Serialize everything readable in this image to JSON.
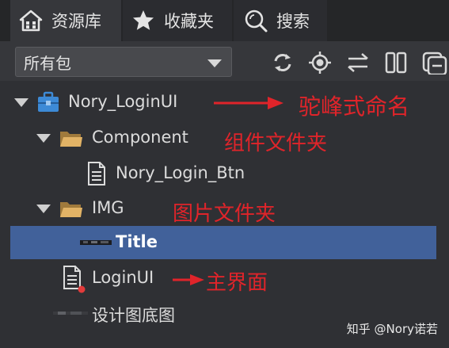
{
  "tabs": [
    {
      "label": "资源库",
      "icon": "home-icon"
    },
    {
      "label": "收藏夹",
      "icon": "star-icon"
    },
    {
      "label": "搜索",
      "icon": "search-icon"
    }
  ],
  "toolbar": {
    "package_filter": "所有包",
    "tools": [
      "refresh-icon",
      "locate-icon",
      "swap-icon",
      "columns-icon",
      "collapse-icon"
    ]
  },
  "tree": [
    {
      "label": "Nory_LoginUI",
      "icon": "package-icon"
    },
    {
      "label": "Component",
      "icon": "folder-icon"
    },
    {
      "label": "Nory_Login_Btn",
      "icon": "component-file-icon"
    },
    {
      "label": "IMG",
      "icon": "folder-icon"
    },
    {
      "label": "Title",
      "icon": "image-thumbnail-icon",
      "selected": true
    },
    {
      "label": "LoginUI",
      "icon": "component-file-icon"
    },
    {
      "label": "设计图底图",
      "icon": "image-thumbnail-icon"
    }
  ],
  "annotations": {
    "camel_case": "驼峰式命名",
    "component_folder": "组件文件夹",
    "image_folder": "图片文件夹",
    "main_ui": "主界面"
  },
  "watermark": "知乎 @Nory诺若",
  "colors": {
    "selection": "#41619a",
    "annotation": "#e0242a",
    "package": "#3d8ad6",
    "folder": "#e2b366"
  }
}
